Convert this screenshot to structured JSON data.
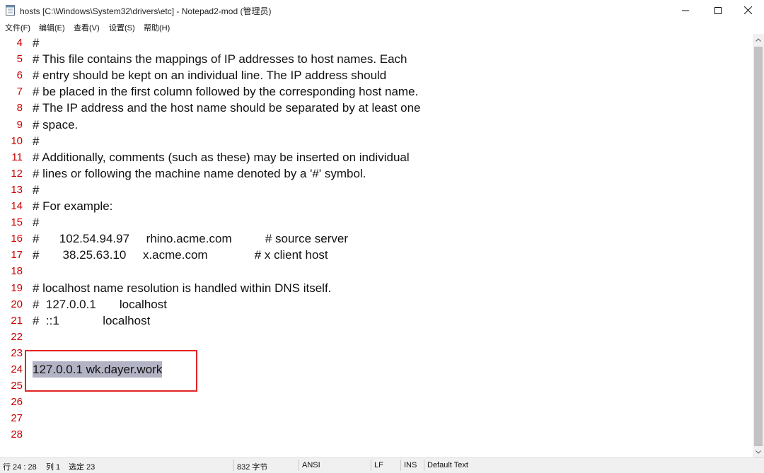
{
  "window": {
    "title": "hosts [C:\\Windows\\System32\\drivers\\etc] - Notepad2-mod (管理员)"
  },
  "menu": [
    "文件(F)",
    "编辑(E)",
    "查看(V)",
    "设置(S)",
    "帮助(H)"
  ],
  "editor": {
    "lines": [
      {
        "n": "4",
        "text": "#"
      },
      {
        "n": "5",
        "text": "# This file contains the mappings of IP addresses to host names. Each"
      },
      {
        "n": "6",
        "text": "# entry should be kept on an individual line. The IP address should"
      },
      {
        "n": "7",
        "text": "# be placed in the first column followed by the corresponding host name."
      },
      {
        "n": "8",
        "text": "# The IP address and the host name should be separated by at least one"
      },
      {
        "n": "9",
        "text": "# space."
      },
      {
        "n": "10",
        "text": "#"
      },
      {
        "n": "11",
        "text": "# Additionally, comments (such as these) may be inserted on individual"
      },
      {
        "n": "12",
        "text": "# lines or following the machine name denoted by a '#' symbol."
      },
      {
        "n": "13",
        "text": "#"
      },
      {
        "n": "14",
        "text": "# For example:"
      },
      {
        "n": "15",
        "text": "#"
      },
      {
        "n": "16",
        "text": "#      102.54.94.97     rhino.acme.com          # source server"
      },
      {
        "n": "17",
        "text": "#       38.25.63.10     x.acme.com              # x client host"
      },
      {
        "n": "18",
        "text": ""
      },
      {
        "n": "19",
        "text": "# localhost name resolution is handled within DNS itself."
      },
      {
        "n": "20",
        "text": "#  127.0.0.1       localhost"
      },
      {
        "n": "21",
        "text": "#  ::1             localhost"
      },
      {
        "n": "22",
        "text": ""
      },
      {
        "n": "23",
        "text": ""
      },
      {
        "n": "24",
        "text": "127.0.0.1 wk.dayer.work"
      },
      {
        "n": "25",
        "text": ""
      },
      {
        "n": "26",
        "text": ""
      },
      {
        "n": "27",
        "text": ""
      },
      {
        "n": "28",
        "text": ""
      }
    ],
    "selected_line_index": 20,
    "colors": {
      "line_numbers": "#cc0000",
      "selection": "#b3b3c6",
      "annotation_box": "#e32424"
    }
  },
  "status": {
    "position": "行 24 : 28",
    "column": "列 1",
    "selection": "选定 23",
    "size": "832 字节",
    "encoding": "ANSI",
    "eol": "LF",
    "mode": "INS",
    "scheme": "Default Text"
  }
}
